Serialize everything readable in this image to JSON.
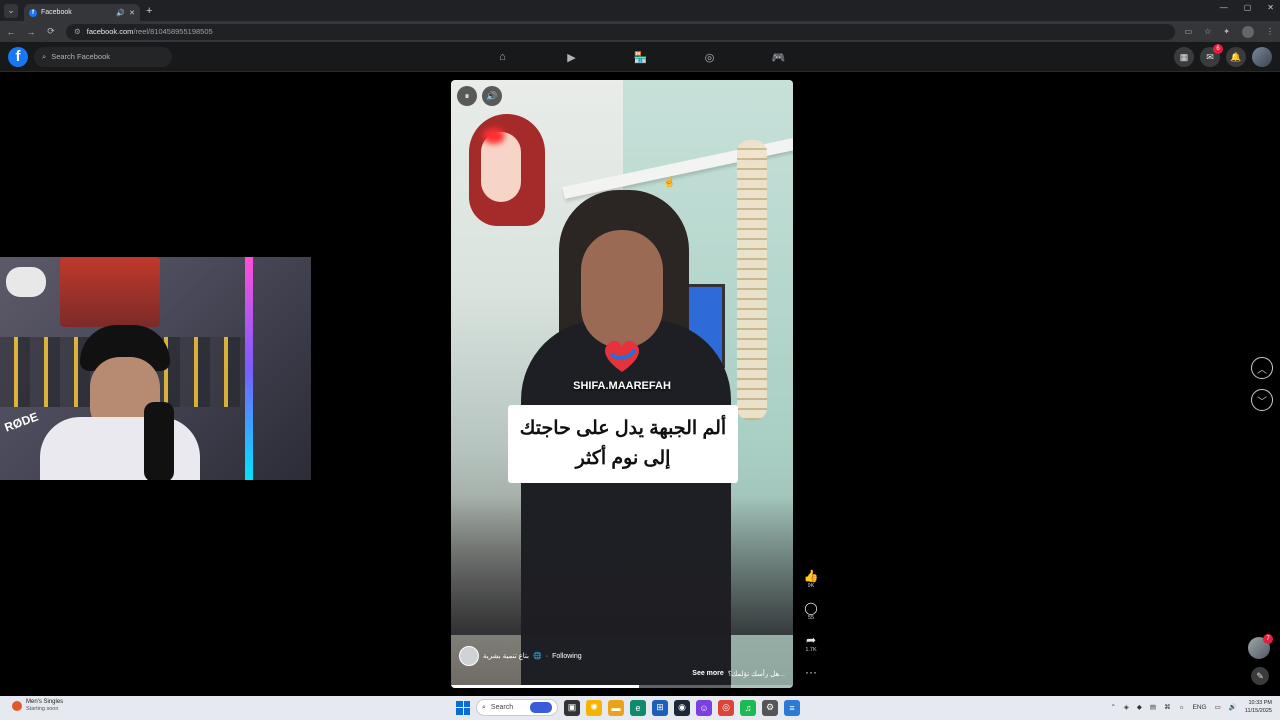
{
  "browser": {
    "tab_title": "Facebook",
    "tab_favicon": "f",
    "url_host": "facebook.com",
    "url_path": "/reel/810458955198505",
    "icons": {
      "back": "←",
      "forward": "→",
      "reload": "⟳",
      "new_tab": "+",
      "close_tab": "✕",
      "audio": "🔊",
      "minimize": "—",
      "maximize": "▢",
      "close": "✕"
    }
  },
  "fb": {
    "logo": "f",
    "search_placeholder": "Search Facebook",
    "nav_icons": [
      "home-icon",
      "video-icon",
      "marketplace-icon",
      "groups-icon",
      "gaming-icon"
    ],
    "nav_glyphs": [
      "⌂",
      "▶",
      "🏪",
      "◎",
      "🎮"
    ],
    "messenger_badge": "6"
  },
  "reel": {
    "watermark": "SHIFA.MAAREFAH",
    "caption_line1": "ألم الجبهة يدل على حاجتك",
    "caption_line2": "إلى نوم أكثر",
    "author": "بتاع تنمية بشرية",
    "following": "Following",
    "desc": "هل رأسك تؤلمك؟...",
    "see_more": "See more",
    "progress": 0.55,
    "pause_glyph": "⏸",
    "volume_glyph": "🔊"
  },
  "actions": {
    "like_count": "9K",
    "comment_count": "55",
    "share_count": "1.7K",
    "more": "···"
  },
  "webcam": {
    "brand": "RØDE"
  },
  "chat": {
    "badge": "7"
  },
  "taskbar": {
    "weather_title": "Men's Singles",
    "weather_sub": "Starting soon",
    "search_label": "Search",
    "lang": "ENG",
    "time": "10:33 PM",
    "date": "11/15/2025"
  }
}
